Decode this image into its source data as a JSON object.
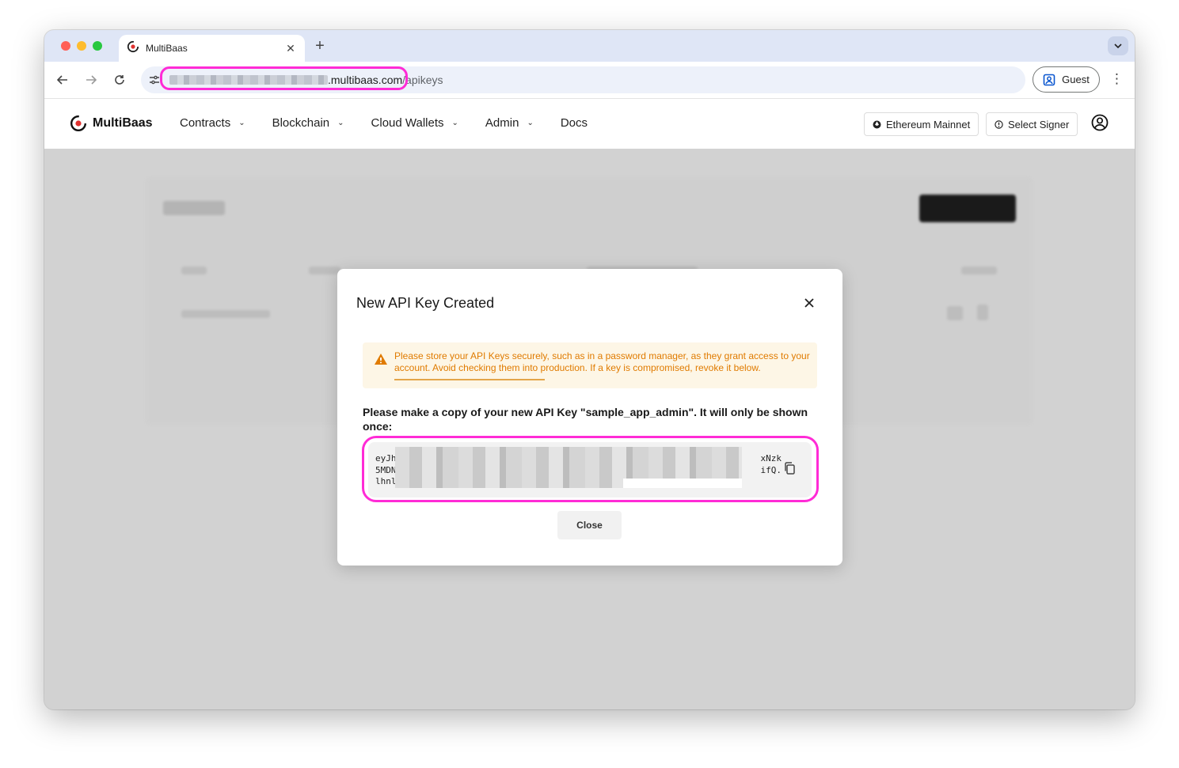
{
  "browser": {
    "tab_title": "MultiBaas",
    "url_domain": ".multibaas.com",
    "url_path": "/apikeys",
    "profile_label": "Guest"
  },
  "app": {
    "brand": "MultiBaas",
    "menu": [
      {
        "label": "Contracts",
        "has_dropdown": true
      },
      {
        "label": "Blockchain",
        "has_dropdown": true
      },
      {
        "label": "Cloud Wallets",
        "has_dropdown": true
      },
      {
        "label": "Admin",
        "has_dropdown": true
      },
      {
        "label": "Docs",
        "has_dropdown": false
      }
    ],
    "network_label": "Ethereum Mainnet",
    "signer_label": "Select Signer"
  },
  "modal": {
    "title": "New API Key Created",
    "warning": "Please store your API Keys securely, such as in a password manager, as they grant access to your account. Avoid checking them into production. If a key is compromised, revoke it below.",
    "prompt": "Please make a copy of your new API Key \"sample_app_admin\". It will only be shown once:",
    "key_line_1_start": "eyJh",
    "key_line_1_end": "xNzk",
    "key_line_2_start": "5MDN",
    "key_line_2_end": "ifQ.",
    "key_line_3_start": "lhnl",
    "close_label": "Close"
  },
  "colors": {
    "highlight": "#ff2bd6",
    "warning_text": "#e07b00",
    "warning_bg": "#fdf6e6",
    "brand_red": "#e0312f"
  },
  "icons": [
    "close-icon",
    "warning-icon",
    "copy-icon",
    "user-circle-icon",
    "network-icon",
    "signer-icon",
    "back-icon",
    "forward-icon",
    "reload-icon"
  ]
}
